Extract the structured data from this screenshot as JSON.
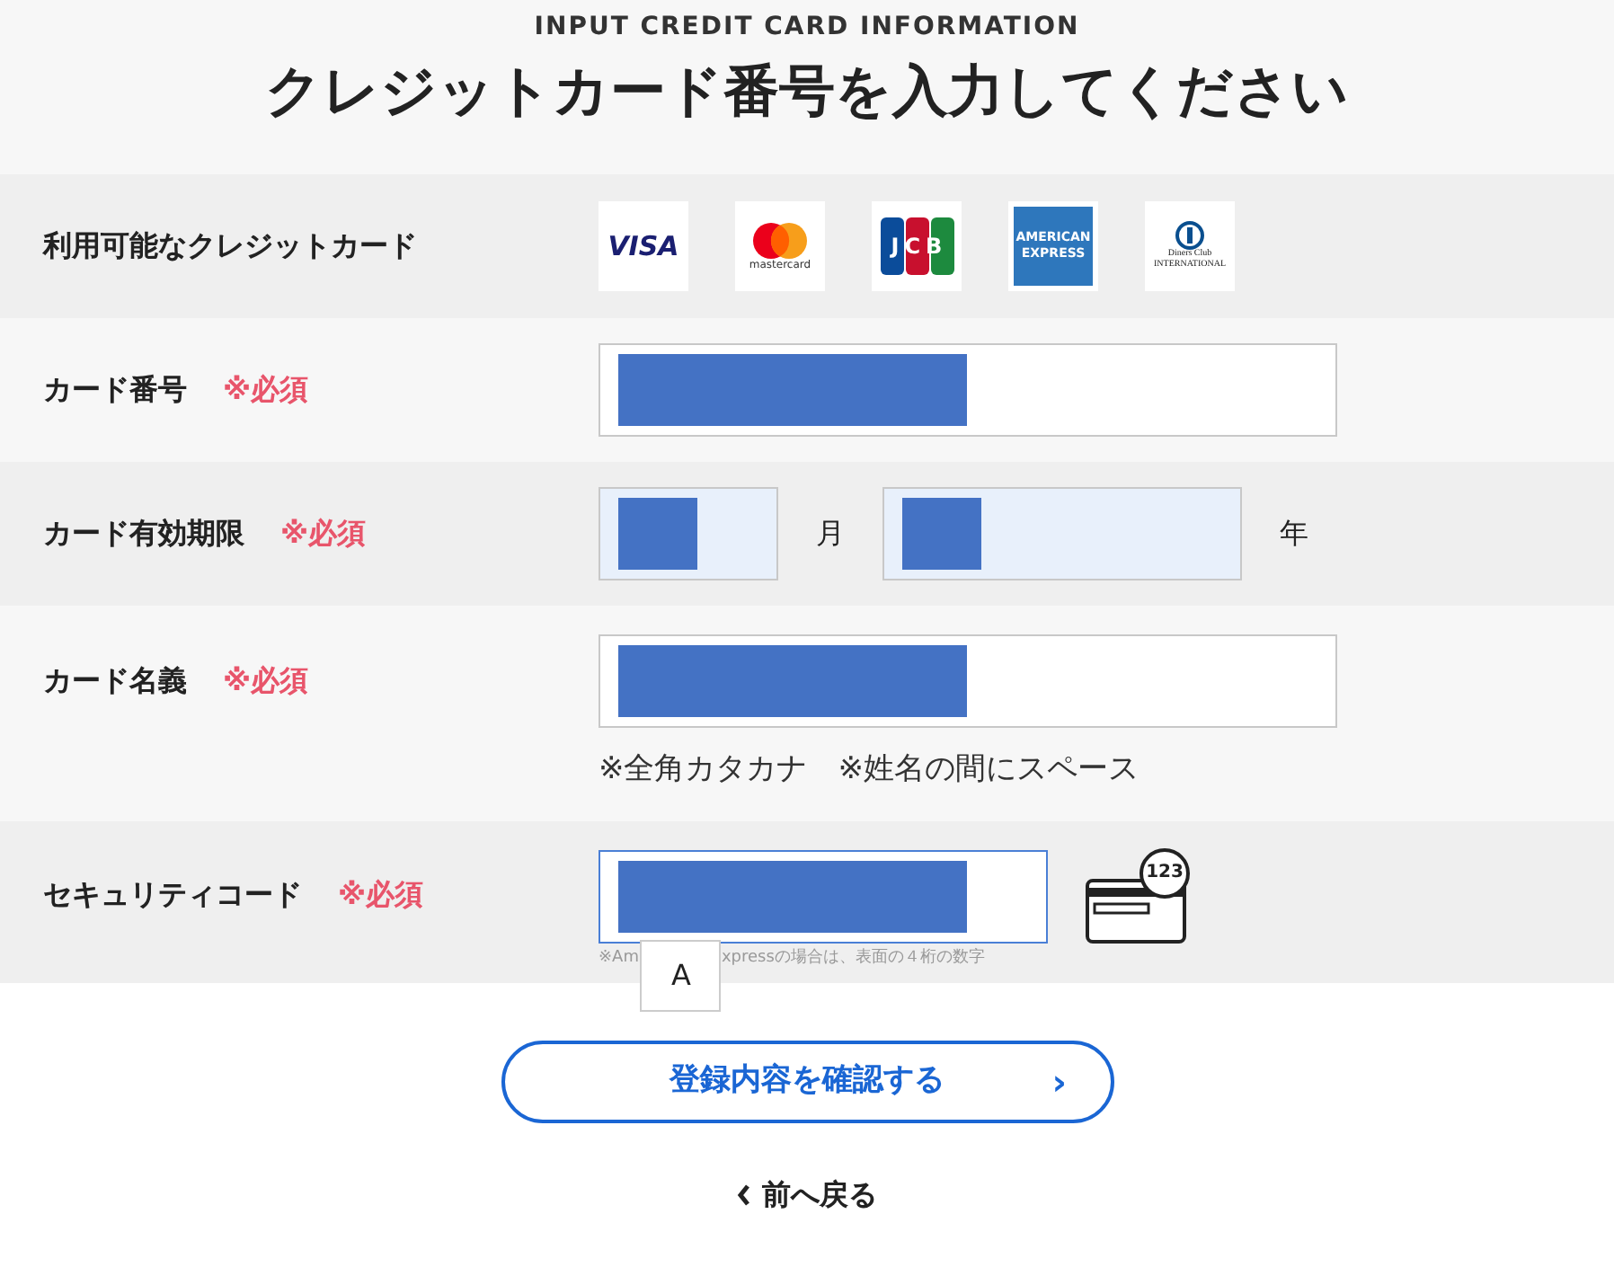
{
  "header": {
    "subtitle": "INPUT CREDIT CARD INFORMATION",
    "title": "クレジットカード番号を入力してください"
  },
  "rows": [
    {
      "kind": "cards",
      "label": "利用可能なクレジットカード",
      "cards": [
        {
          "kind": "visa",
          "text": "VISA"
        },
        {
          "kind": "mastercard",
          "text": "mastercard"
        },
        {
          "kind": "jcb",
          "text": "JCB"
        },
        {
          "kind": "amex",
          "text": "AMERICAN EXPRESS"
        },
        {
          "kind": "diners",
          "text": "Diners Club INTERNATIONAL"
        }
      ]
    },
    {
      "kind": "text",
      "label": "カード番号",
      "required": "※必須",
      "field": {
        "redacted": true,
        "highlighted": false,
        "focused": false
      }
    },
    {
      "kind": "expiry",
      "label": "カード有効期限",
      "required": "※必須",
      "month": {
        "redacted": true,
        "highlighted": true
      },
      "month_unit": "月",
      "year": {
        "redacted": true,
        "highlighted": true
      },
      "year_unit": "年"
    },
    {
      "kind": "text",
      "label": "カード名義",
      "required": "※必須",
      "field": {
        "redacted": true,
        "highlighted": false,
        "focused": false
      },
      "note": "※全角カタカナ　※姓名の間にスペース"
    },
    {
      "kind": "security",
      "label": "セキュリティコード",
      "required": "※必須",
      "field": {
        "redacted": true,
        "highlighted": false,
        "focused": true
      },
      "note_start": "※Am",
      "note_end": "xpressの場合は、表面の４桁の数字",
      "popup": "A",
      "badge": "123"
    }
  ],
  "confirm_button": {
    "label": "登録内容を確認する",
    "arrow": "›"
  },
  "back_link": {
    "label": "前へ戻る"
  }
}
